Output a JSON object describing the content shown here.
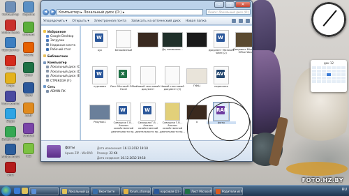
{
  "desktop": {
    "left_icons": [
      {
        "label": "Компьютер",
        "icon": "computer-icon",
        "color": "#6e8fb8"
      },
      {
        "label": "Adobe Reader",
        "icon": "pdf-icon",
        "color": "#c9302c"
      },
      {
        "label": "Программы",
        "icon": "folder-icon",
        "color": "#3e7fc1"
      },
      {
        "label": "Opera",
        "icon": "opera-icon",
        "color": "#d42a1c"
      },
      {
        "label": "Fraps",
        "icon": "fraps-icon",
        "color": "#e4b21c"
      },
      {
        "label": "Total Commander",
        "icon": "floppy-icon",
        "color": "#4a4aa0"
      },
      {
        "label": "Skype",
        "icon": "skype-icon",
        "color": "#2ea4e4"
      },
      {
        "label": "Google Chrome",
        "icon": "chrome-icon",
        "color": "#34a853"
      },
      {
        "label": "Adobe Photoshop",
        "icon": "photoshop-icon",
        "color": "#2b5d9b"
      },
      {
        "label": "Nero",
        "icon": "nero-icon",
        "color": "#b31b1b"
      }
    ],
    "right_col_icons": [
      {
        "label": "Корзина",
        "icon": "recycle-bin-icon",
        "color": "#5a8fc4"
      },
      {
        "label": "uTorrent",
        "icon": "utorrent-icon",
        "color": "#5bae3a"
      },
      {
        "label": "Mozilla",
        "icon": "firefox-icon",
        "color": "#e66000"
      },
      {
        "label": "Excel",
        "icon": "excel-icon",
        "color": "#1e7145"
      },
      {
        "label": "Word",
        "icon": "word-icon",
        "color": "#2b579a"
      },
      {
        "label": "AIMP",
        "icon": "aimp-icon",
        "color": "#e08a1e"
      },
      {
        "label": "WinRAR",
        "icon": "winrar-icon",
        "color": "#7a45a8"
      },
      {
        "label": "ICQ",
        "icon": "icq-icon",
        "color": "#7cc242"
      }
    ],
    "watermark": "FOTO.HZ.BY",
    "calendar_title": "дек 12"
  },
  "window": {
    "address_path": "Компьютер ▸ Локальный диск (D:) ▸",
    "search_placeholder": "Поиск: Локальный диск (D:)",
    "toolbar": [
      "Упорядочить ▾",
      "Открыть ▾",
      "Электронная почта",
      "Записать на оптический диск",
      "Новая папка"
    ],
    "nav": [
      {
        "label": "Избранное",
        "type": "h",
        "color": "#f3c84a"
      },
      {
        "label": "Google Desktop",
        "type": "sub",
        "color": "#5b8fd6"
      },
      {
        "label": "Загрузки",
        "type": "sub",
        "color": "#4b79b9"
      },
      {
        "label": "Недавние места",
        "type": "sub",
        "color": "#6a87a8"
      },
      {
        "label": "Рабочий стол",
        "type": "sub",
        "color": "#3e6fae"
      },
      {
        "label": "Библиотеки",
        "type": "h",
        "color": "#e9c260"
      },
      {
        "label": "Компьютер",
        "type": "h",
        "color": "#7c9ac1"
      },
      {
        "label": "Локальный диск (C:)",
        "type": "sub",
        "color": "#8a98aa"
      },
      {
        "label": "Локальный диск (D:)",
        "type": "sub",
        "color": "#8a98aa"
      },
      {
        "label": "Локальный диск (E:)",
        "type": "sub",
        "color": "#8a98aa"
      },
      {
        "label": "СТРЕКОЗА (F:)",
        "type": "sub",
        "color": "#8a98aa"
      },
      {
        "label": "Сеть",
        "type": "h",
        "color": "#6f9acb"
      },
      {
        "label": "ADMIN-ПК",
        "type": "sub",
        "color": "#7b8fa8"
      }
    ],
    "files": [
      {
        "label": "аук",
        "kind": "doc",
        "badge": "W",
        "color": "#2b579a"
      },
      {
        "label": "Безымянный",
        "kind": "doc",
        "badge": "",
        "color": "#ffffff"
      },
      {
        "label": "",
        "kind": "img",
        "color": "#3a2a20"
      },
      {
        "label": "Да, возможно...",
        "kind": "img",
        "color": "#20302a"
      },
      {
        "label": "",
        "kind": "img",
        "color": "#1a1a1a"
      },
      {
        "label": "Документ Microsoft Word (2)",
        "kind": "doc",
        "badge": "W",
        "color": "#2b579a"
      },
      {
        "label": "Документ Microsoft Office Word",
        "kind": "img",
        "color": "#5b4a30"
      },
      {
        "label": "курсовая",
        "kind": "doc",
        "badge": "W",
        "color": "#2b579a"
      },
      {
        "label": "Лист Microsoft Office Excel",
        "kind": "doc",
        "badge": "X",
        "color": "#1e7145"
      },
      {
        "label": "Новый текстовый документ",
        "kind": "doc",
        "badge": "",
        "color": "#ffffff"
      },
      {
        "label": "Новый текстовый документ (2)",
        "kind": "doc",
        "badge": "",
        "color": "#ffffff"
      },
      {
        "label": "ПФЩ",
        "kind": "img",
        "color": "#e9e4da"
      },
      {
        "label": "порослекк",
        "kind": "doc",
        "badge": "AVI",
        "color": "#23466e"
      },
      {
        "label": "Рисунок1",
        "kind": "img",
        "color": "#6a7f9a"
      },
      {
        "label": "Савицкая Г.В. - Анализ хозяйственной деятельности пр...",
        "kind": "doc",
        "badge": "W",
        "color": "#2b579a"
      },
      {
        "label": "Савицкая Г.В. - Анализ хозяйственной деятельности пр...",
        "kind": "doc",
        "badge": "W",
        "color": "#2b579a"
      },
      {
        "label": "Савицкая Г.В. - Анализ хозяйственной деятельности пр...",
        "kind": "doc",
        "badge": "",
        "color": "#e2d07a"
      },
      {
        "label": "я",
        "kind": "img",
        "color": "#3b2a1e"
      },
      {
        "label": "фоты",
        "kind": "doc",
        "badge": "RAR",
        "color": "#6d3ba0"
      }
    ],
    "details": {
      "name": "фоты",
      "type": "Архив ZIP - WinRAR",
      "modified_label": "Дата изменения:",
      "modified_value": "16.12.2012 19:18",
      "size_label": "Размер:",
      "size_value": "22 Кб",
      "created_label": "Дата создания:",
      "created_value": "16.12.2012 19:18"
    }
  },
  "taskbar": {
    "buttons": [
      {
        "label": "",
        "color": "#5b8fd6"
      },
      {
        "label": "Локальный диск (D:)",
        "color": "#e0c25a"
      },
      {
        "label": "Вконтакте",
        "color": "#3b6ea8"
      },
      {
        "label": "forum_sticer@mail.ru",
        "color": "#e1b343"
      },
      {
        "label": "курсовая (2) - Micro...",
        "color": "#2b579a"
      },
      {
        "label": "Лист Microsoft Office",
        "color": "#1e7145"
      },
      {
        "label": "Родители из Москвы...",
        "color": "#d85a1f"
      }
    ],
    "tray": "RU"
  }
}
